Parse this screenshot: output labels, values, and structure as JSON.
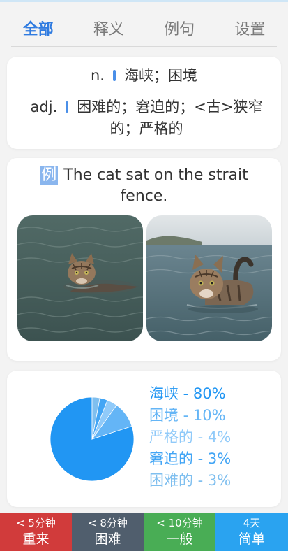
{
  "tabs": [
    {
      "label": "全部",
      "active": true
    },
    {
      "label": "释义",
      "active": false
    },
    {
      "label": "例句",
      "active": false
    },
    {
      "label": "设置",
      "active": false
    }
  ],
  "definitions": [
    {
      "pos": "n.",
      "meaning": "海峡；困境"
    },
    {
      "pos": "adj.",
      "meaning": "困难的；窘迫的；<古>狭窄的；严格的"
    }
  ],
  "example": {
    "badge": "例",
    "sentence": "The cat sat on the strait fence."
  },
  "chart_data": {
    "type": "pie",
    "slices": [
      {
        "label": "海峡",
        "value": 80,
        "display": "海峡 - 80%",
        "color": "#2196f3"
      },
      {
        "label": "困境",
        "value": 10,
        "display": "困境 - 10%",
        "color": "#64b5f6"
      },
      {
        "label": "严格的",
        "value": 4,
        "display": "严格的 - 4%",
        "color": "#90caf9"
      },
      {
        "label": "窘迫的",
        "value": 3,
        "display": "窘迫的 - 3%",
        "color": "#42a5f5"
      },
      {
        "label": "困难的",
        "value": 3,
        "display": "困难的 - 3%",
        "color": "#7fbfef"
      }
    ]
  },
  "review_buttons": [
    {
      "time": "< 5分钟",
      "label": "重来",
      "color": "#d13b3b"
    },
    {
      "time": "< 8分钟",
      "label": "困难",
      "color": "#505e6d"
    },
    {
      "time": "< 10分钟",
      "label": "一般",
      "color": "#49ad55"
    },
    {
      "time": "4天",
      "label": "简单",
      "color": "#2aa3f0"
    }
  ]
}
